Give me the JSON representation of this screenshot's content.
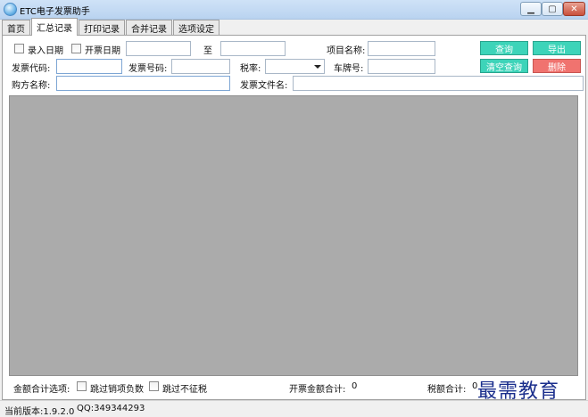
{
  "window": {
    "title": "ETC电子发票助手"
  },
  "tabs": [
    {
      "label": "首页"
    },
    {
      "label": "汇总记录"
    },
    {
      "label": "打印记录"
    },
    {
      "label": "合并记录"
    },
    {
      "label": "选项设定"
    }
  ],
  "filters": {
    "entry_date_label": "录入日期",
    "invoice_date_label": "开票日期",
    "to_label": "至",
    "item_name_label": "项目名称:",
    "invoice_code_label": "发票代码:",
    "invoice_number_label": "发票号码:",
    "tax_rate_label": "税率:",
    "plate_label": "车牌号:",
    "buyer_name_label": "购方名称:",
    "invoice_file_label": "发票文件名:"
  },
  "buttons": {
    "query": "查询",
    "export": "导出",
    "clear_query": "清空查询",
    "delete": "删除"
  },
  "totals": {
    "options_label": "金额合计选项:",
    "skip_negative_label": "跳过销项负数",
    "skip_nontax_label": "跳过不征税",
    "invoice_total_label": "开票金额合计:",
    "invoice_total_value": "0",
    "tax_total_label": "税额合计:",
    "tax_total_value": "0"
  },
  "status": {
    "version": "当前版本:1.9.2.0",
    "qq": "QQ:349344293"
  },
  "watermark": "最需教育",
  "colors": {
    "teal": "#3dd4b9",
    "red": "#f0736f",
    "grid": "#ababab"
  }
}
